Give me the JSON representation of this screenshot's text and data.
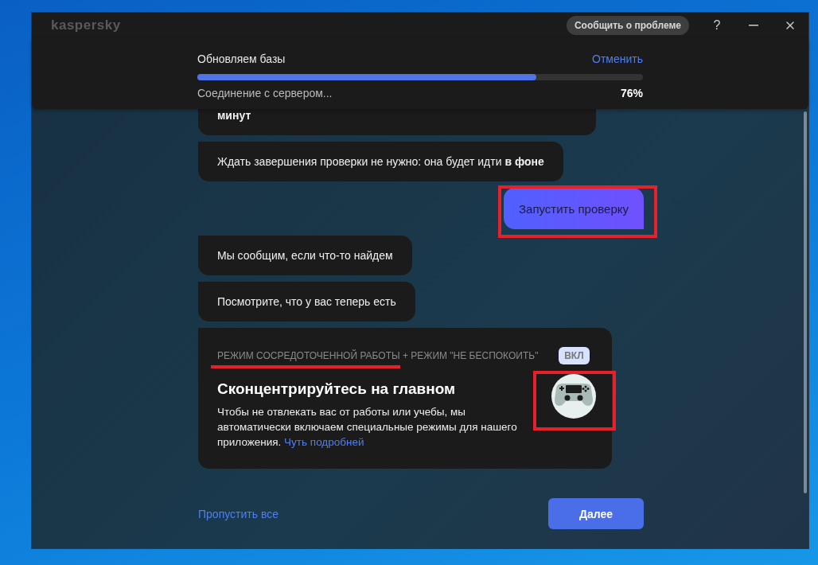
{
  "window": {
    "title": "kaspersky",
    "report_button": "Сообщить о проблеме",
    "help": "?"
  },
  "update": {
    "title": "Обновляем базы",
    "cancel": "Отменить",
    "level": 0.76,
    "status": "Соединение с сервером...",
    "percent": "76%"
  },
  "messages": [
    {
      "kind": "bot",
      "text": "**минут**"
    },
    {
      "kind": "bot",
      "text": "Ждать завершения проверки не нужно: она будет идти **в фоне**"
    },
    {
      "kind": "action",
      "text": "Запустить проверку"
    },
    {
      "kind": "bot",
      "text": "Мы сообщим, если что-то найдем"
    },
    {
      "kind": "bot",
      "text": "Посмотрите, что у вас теперь есть"
    }
  ],
  "card": {
    "label": "РЕЖИМ СОСРЕДОТОЧЕННОЙ РАБОТЫ + РЕЖИМ \"НЕ БЕСПОКОИТЬ\"",
    "on": true,
    "badge": "ВКЛ",
    "title": "Сконцентрируйтесь на главном",
    "text": "Чтобы не отвлекать вас от работы или учебы, мы автоматически включаем специальные режимы для нашего приложения.",
    "link": "Чуть подробней"
  },
  "footer": {
    "skip": "Пропустить все",
    "next": "Далее"
  }
}
